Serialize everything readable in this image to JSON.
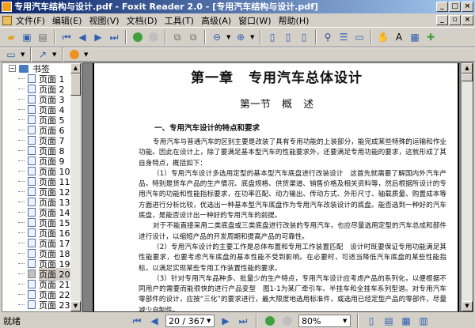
{
  "window": {
    "title": "专用汽车结构与设计.pdf - Foxit Reader 2.0 - [专用汽车结构与设计.pdf]",
    "minimize": "_",
    "maximize": "□",
    "close": "×",
    "restore": "▫"
  },
  "menu": [
    "文件(F)",
    "编辑(E)",
    "视图(V)",
    "文档(D)",
    "工具(T)",
    "高级(A)",
    "窗口(W)",
    "帮助(H)"
  ],
  "sidebar": {
    "root": "书签",
    "items": [
      "页面 1",
      "页面 2",
      "页面 3",
      "页面 4",
      "页面 5",
      "页面 6",
      "页面 7",
      "页面 8",
      "页面 9",
      "页面 10",
      "页面 11",
      "页面 12",
      "页面 13",
      "页面 14",
      "页面 15",
      "页面 16",
      "页面 17",
      "页面 18",
      "页面 19",
      "页面 20",
      "页面 21",
      "页面 22",
      "页面 23"
    ],
    "selected_index": 19
  },
  "document": {
    "chapter": "第一章 专用汽车总体设计",
    "section": "第一节 概 述",
    "subheading": "一、专用汽车设计的特点和要求",
    "paragraphs": [
      "专用汽车与普通汽车的区别主要是改装了具有专用功能的上装部分，能完成某些特殊的运输和作业功能。因此在设计上，除了要满足基本型汽车的性能要求外，还要满足专用功能的要求，这就形成了其自身特点，概括如下：",
      "（1）专用汽车设计多选用定型的基本型汽车底盘进行改装设计　这首先就需要了解国内外汽车产品，特别是货车产品的生产情况、底盘规格、供货渠道、销售价格及相关资料等，然后根据所设计的专用汽车的功能和性能指标要求，在功率匹配、动力输出、传动方式、外形尺寸、轴载质量、购置成本等方面进行分析比较，优选出一种基本型汽车底盘作为专用汽车改装设计的底盘。能否选到一种好的汽车底盘，是能否设计出一种好的专用汽车的前提。",
      "对于不能直接采用二类底盘或三类底盘进行改装的专用汽车，也应尽量选用定型的汽车总成和部件进行设计，以缩短产品的开发周期和提高产品的可靠性。",
      "（2）专用汽车设计的主要工作是总体布置和专用工作装置匹配　设计时既要保证专用功能满足其性能要求，也要考虑汽车底盘的基本性能不受到影响。在必要时，可适当降低汽车底盘的某些性能指标，以满足实现某些专用工作装置性能的要求。",
      "（3）针对专用汽车品种多、批量少的生产特点，专用汽车设计应考虑产品的系列化，以便根据不同用户的需要而能很快的进行产品变型　图1-1为某厂牵引车、半挂车和全挂车系列型谱。对专用汽车零部件的设计，应按“三化”的要求进行，最大限度地选用标准件，或选用已经定型产品的零部件，尽量减少自制件。"
    ]
  },
  "status": {
    "text": "就绪",
    "page": "20 / 367",
    "zoom": "80%"
  }
}
